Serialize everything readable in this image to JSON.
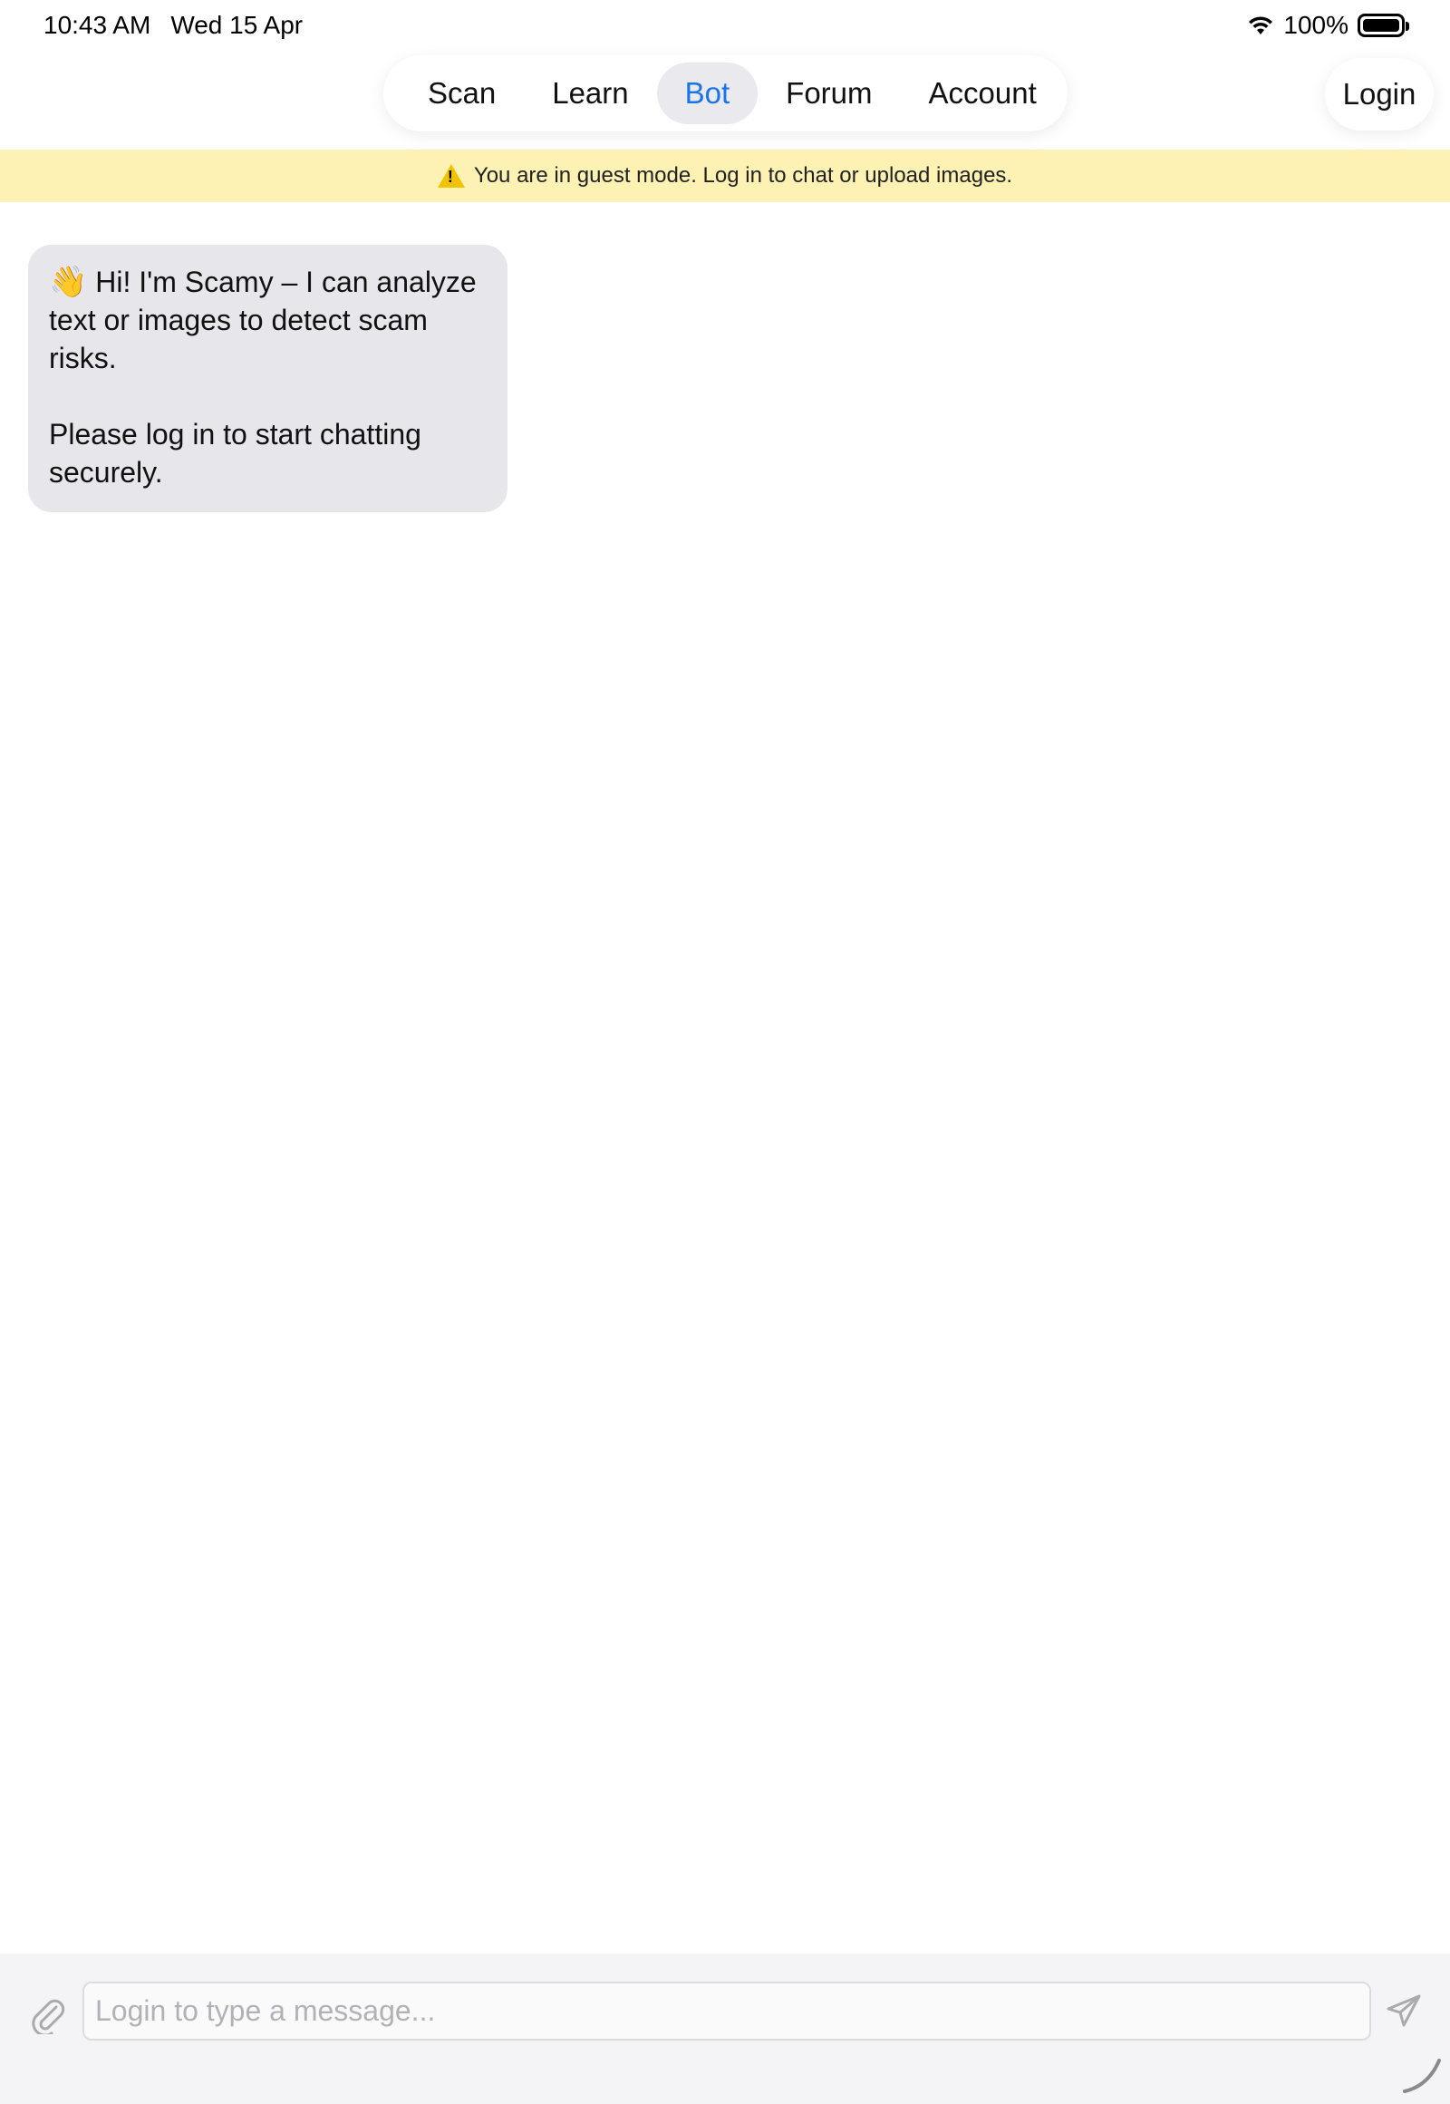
{
  "status_bar": {
    "time": "10:43 AM",
    "date": "Wed 15 Apr",
    "battery_percent": "100%",
    "battery_level": 1.0
  },
  "nav": {
    "tabs": [
      {
        "label": "Scan"
      },
      {
        "label": "Learn"
      },
      {
        "label": "Bot"
      },
      {
        "label": "Forum"
      },
      {
        "label": "Account"
      }
    ],
    "active_tab": "Bot",
    "login_label": "Login"
  },
  "banner": {
    "icon": "warning-icon",
    "text": "You are in guest mode. Log in to chat or upload images."
  },
  "chat": {
    "messages": [
      {
        "sender": "bot",
        "icon": "waving-hand-icon",
        "emoji": "👋",
        "line1": "Hi! I'm Scamy – I can analyze text or images to detect scam risks.",
        "line2": "Please log in to start chatting securely."
      }
    ]
  },
  "composer": {
    "placeholder": "Login to type a message...",
    "value": "",
    "attach_icon": "paperclip-icon",
    "send_icon": "send-icon"
  },
  "colors": {
    "accent": "#1a73e8",
    "banner_bg": "#fdf1b3",
    "bubble_bg": "#e6e6eb"
  }
}
